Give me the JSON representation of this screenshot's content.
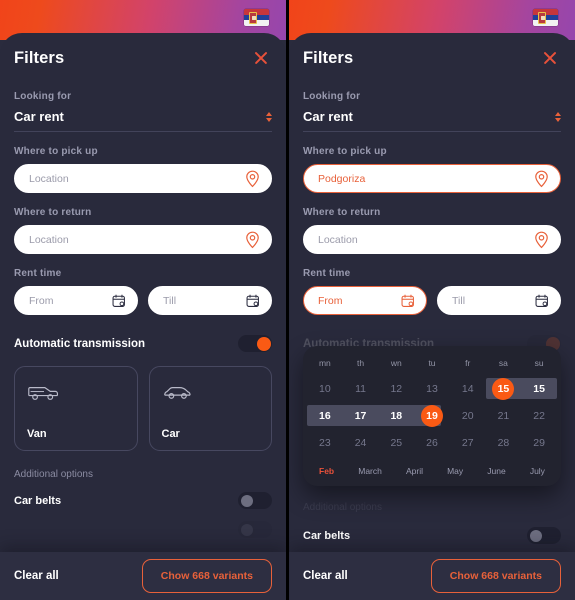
{
  "app": {
    "flag": "serbia-flag",
    "accent": "#fa5a14",
    "accent_soft": "#e8613a",
    "close_icon": "close-icon",
    "sheet_bg": "#292a3c",
    "gradient_from": "#f1441a",
    "gradient_to": "#9646ad"
  },
  "sheet": {
    "title": "Filters"
  },
  "looking_for": {
    "label": "Looking for",
    "value": "Car rent",
    "spinner_icon": "spinner-up-down-icon"
  },
  "pickup": {
    "label": "Where to pick up",
    "placeholder": "Location",
    "value_left": "",
    "value_right": "Podgoriza",
    "pin_icon": "map-pin-icon"
  },
  "dropoff": {
    "label": "Where to return",
    "placeholder": "Location",
    "value": "",
    "pin_icon": "map-pin-icon"
  },
  "rent_time": {
    "label": "Rent time",
    "from_placeholder": "From",
    "till_placeholder": "Till",
    "calendar_icon": "calendar-icon"
  },
  "transmission": {
    "label": "Automatic transmission",
    "state": "on"
  },
  "vehicles": [
    {
      "name": "Van",
      "icon": "van-icon"
    },
    {
      "name": "Car",
      "icon": "car-icon"
    }
  ],
  "additional": {
    "label": "Additional options",
    "options": [
      {
        "label": "Car belts",
        "state": "off"
      }
    ]
  },
  "footer": {
    "clear_label": "Clear all",
    "cta_label": "Chow 668 variants"
  },
  "calendar": {
    "weekdays": [
      "mn",
      "th",
      "wn",
      "tu",
      "fr",
      "sa",
      "su"
    ],
    "rows": [
      [
        "10",
        "11",
        "12",
        "13",
        "14",
        "15",
        "15"
      ],
      [
        "16",
        "17",
        "18",
        "19",
        "20",
        "21",
        "22"
      ],
      [
        "23",
        "24",
        "25",
        "26",
        "27",
        "28",
        "29"
      ]
    ],
    "selected_start": "15",
    "selected_end": "19",
    "months": [
      "Feb",
      "March",
      "April",
      "May",
      "June",
      "July"
    ],
    "active_month": "Feb"
  }
}
